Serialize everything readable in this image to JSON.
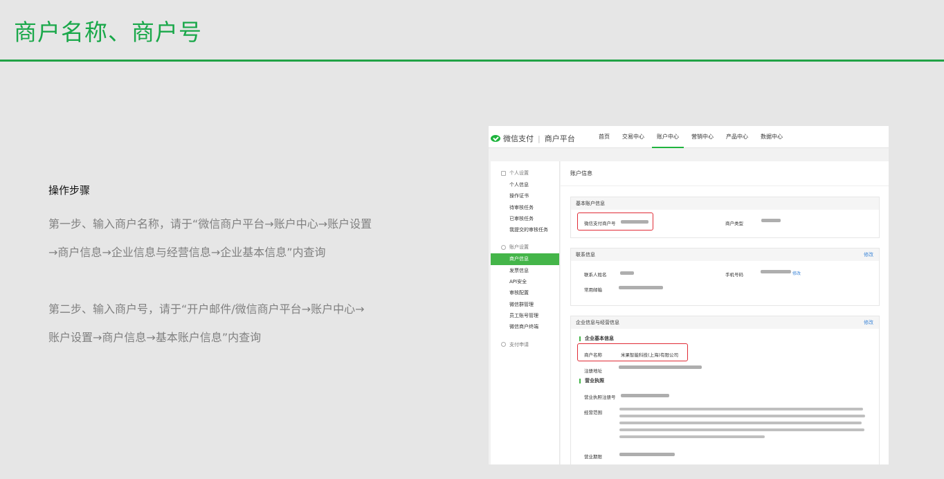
{
  "slide": {
    "title": "商户名称、商户号"
  },
  "instructions": {
    "heading": "操作步骤",
    "step1_line1": "第一步、输入商户名称，请于“微信商户平台→账户中心→账户设置",
    "step1_line2": "→商户信息→企业信息与经营信息→企业基本信息”内查询",
    "step2_line1": "第二步、输入商户号，请于“开户邮件/微信商户平台→账户中心→",
    "step2_line2": "账户设置→商户信息→基本账户信息”内查询"
  },
  "screenshot": {
    "brand": {
      "logo_icon": "wechat-pay-icon",
      "name": "微信支付",
      "platform": "商户平台"
    },
    "nav": [
      {
        "label": "首页",
        "active": false
      },
      {
        "label": "交易中心",
        "active": false
      },
      {
        "label": "账户中心",
        "active": true
      },
      {
        "label": "营销中心",
        "active": false
      },
      {
        "label": "产品中心",
        "active": false
      },
      {
        "label": "数据中心",
        "active": false
      }
    ],
    "sidebar": {
      "group_personal": "个人设置",
      "personal_items": [
        "个人信息",
        "操作证书",
        "待审核任务",
        "已审核任务",
        "我提交的审核任务"
      ],
      "group_account": "账户设置",
      "account_items": [
        "商户信息",
        "发票信息",
        "API安全",
        "审核配置",
        "微信群管理",
        "员工账号管理",
        "微信商户终端"
      ],
      "group_apply": "支付申请"
    },
    "main": {
      "title": "账户信息",
      "basic": {
        "title": "基本账户信息",
        "merchant_id_label": "微信支付商户号",
        "merchant_type_label": "商户类型"
      },
      "contact": {
        "title": "联系信息",
        "edit": "修改",
        "name_label": "联系人姓名",
        "phone_label": "手机号码",
        "phone_edit": "修改",
        "email_label": "常用邮箱"
      },
      "company": {
        "title": "企业信息与经营信息",
        "edit": "修改",
        "basic_title": "企业基本信息",
        "name_label": "商户名称",
        "name_value": "米果智能科技(上海)有限公司",
        "address_label": "注册地址",
        "license_title": "营业执照",
        "license_no_label": "营业执照注册号",
        "scope_label": "经营范围",
        "term_label": "营业期限"
      }
    },
    "colors": {
      "brand_green": "#44b549",
      "highlight_red": "#e02b35",
      "link_blue": "#3f87d8"
    }
  }
}
